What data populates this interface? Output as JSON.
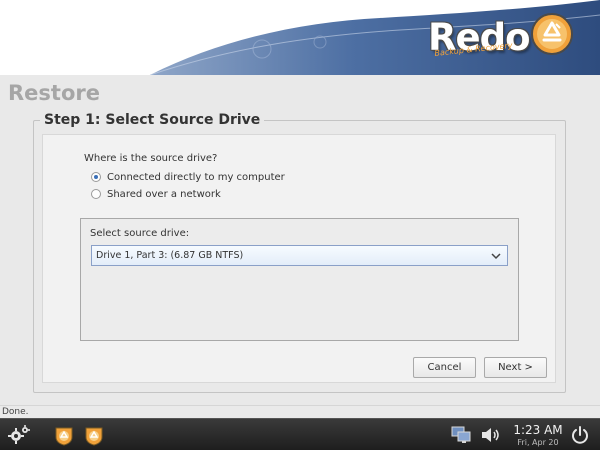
{
  "brand": {
    "name": "Redo",
    "tagline": "Backup & Recovery",
    "accent_color": "#f0a13a",
    "swoosh_color": "#3d5f93"
  },
  "page": {
    "title": "Restore",
    "step_title": "Step 1: Select Source Drive"
  },
  "source": {
    "question": "Where is the source drive?",
    "options": [
      {
        "label": "Connected directly to my computer",
        "selected": true
      },
      {
        "label": "Shared over a network",
        "selected": false
      }
    ]
  },
  "drive": {
    "label": "Select source drive:",
    "selected_value": "Drive 1, Part 3: (6.87 GB NTFS)"
  },
  "buttons": {
    "cancel": "Cancel",
    "next": "Next >"
  },
  "status": {
    "text": "Done."
  },
  "taskbar": {
    "icons": [
      "gear-icon",
      "redo-app-icon",
      "redo-app-icon",
      "network-icon",
      "volume-icon",
      "power-icon"
    ],
    "time": "1:23 AM",
    "date": "Fri, Apr 20"
  }
}
